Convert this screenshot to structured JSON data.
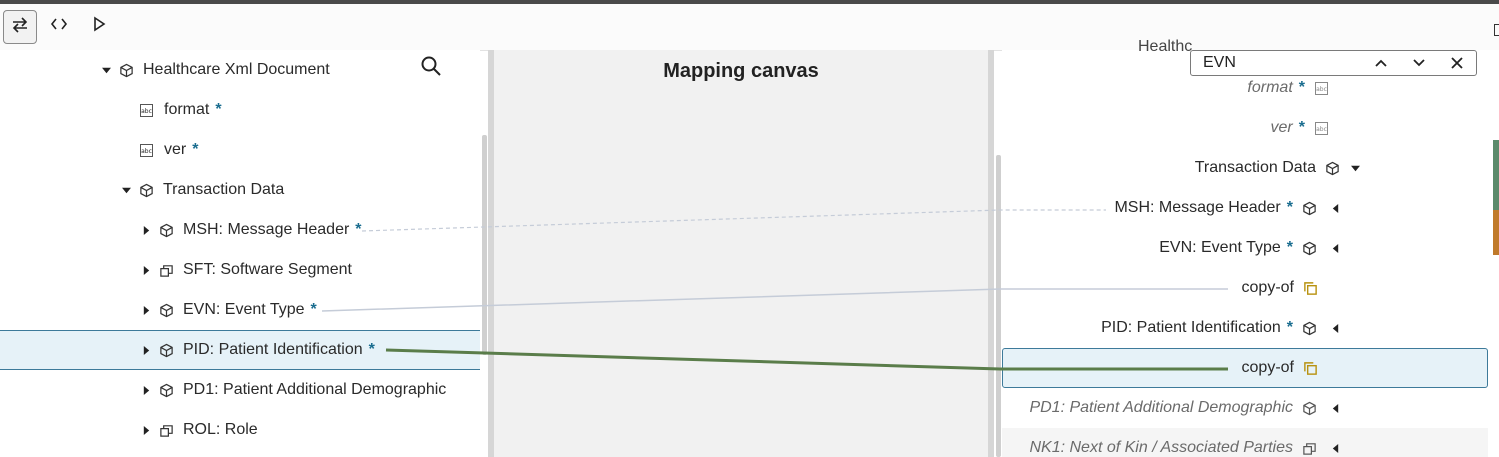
{
  "toolbar": {
    "buttons": [
      {
        "icon": "swap-arrows-icon",
        "active": true
      },
      {
        "icon": "code-brackets-icon"
      },
      {
        "icon": "play-icon"
      }
    ]
  },
  "source_tree": {
    "root": {
      "label": "Healthcare Xml Document",
      "icon": "cube-icon"
    },
    "items": [
      {
        "label": "format",
        "required": "*",
        "icon": "abc-icon"
      },
      {
        "label": "ver",
        "required": "*",
        "icon": "abc-icon"
      },
      {
        "label": "Transaction Data",
        "icon": "cube-icon",
        "expanded": true
      },
      {
        "label": "MSH: Message Header",
        "required": "*",
        "icon": "cube-icon"
      },
      {
        "label": "SFT: Software Segment",
        "icon": "repeat-group-icon"
      },
      {
        "label": "EVN: Event Type",
        "required": "*",
        "icon": "cube-icon"
      },
      {
        "label": "PID: Patient Identification",
        "required": "*",
        "icon": "cube-icon",
        "selected": true
      },
      {
        "label": "PD1: Patient Additional Demographic",
        "icon": "cube-icon"
      },
      {
        "label": "ROL: Role",
        "icon": "repeat-group-icon"
      }
    ]
  },
  "mapping_canvas": {
    "title": "Mapping canvas"
  },
  "target_tree": {
    "clipped_label": "Healthc",
    "find": {
      "value": "EVN"
    },
    "items": [
      {
        "label": "format",
        "required": "*",
        "italic": true,
        "icon": "abc-icon"
      },
      {
        "label": "ver",
        "required": "*",
        "italic": true,
        "icon": "abc-icon"
      },
      {
        "label": "Transaction Data",
        "icon": "cube-icon",
        "expanded": true
      },
      {
        "label": "MSH: Message Header",
        "required": "*",
        "icon": "cube-icon"
      },
      {
        "label": "EVN: Event Type",
        "required": "*",
        "icon": "cube-icon"
      },
      {
        "label": "copy-of",
        "icon": "copy-icon"
      },
      {
        "label": "PID: Patient Identification",
        "required": "*",
        "icon": "cube-icon"
      },
      {
        "label": "copy-of",
        "icon": "copy-icon",
        "selected": true
      },
      {
        "label": "PD1: Patient Additional Demographic",
        "italic": true,
        "icon": "cube-icon"
      },
      {
        "label": "NK1: Next of Kin / Associated Parties",
        "italic": true,
        "icon": "repeat-group-icon"
      }
    ]
  },
  "colors": {
    "mapping_active": "#5a7d4a",
    "mapping_inactive": "#c5ccd8",
    "required_marker": "#1a6d8f",
    "copy_icon": "#b8920f",
    "selection": "#e6f2f8"
  }
}
